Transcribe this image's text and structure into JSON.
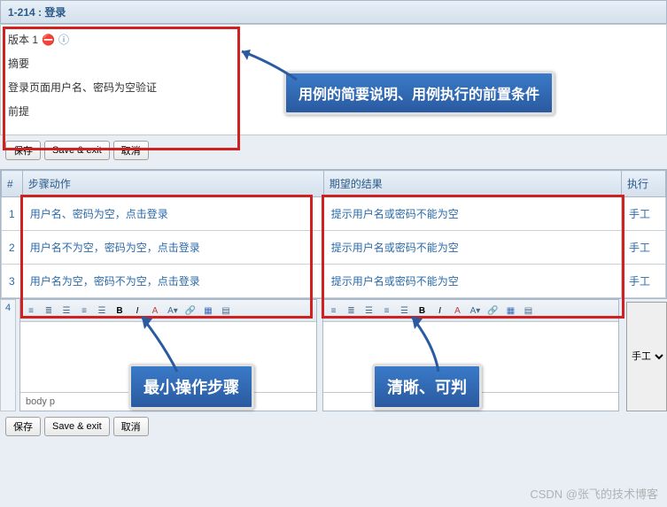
{
  "header": {
    "title": "1-214 : 登录"
  },
  "summary": {
    "version_label": "版本 1",
    "abstract_label": "摘要",
    "abstract_text": "登录页面用户名、密码为空验证",
    "precondition_label": "前提"
  },
  "buttons": {
    "save": "保存",
    "save_exit": "Save & exit",
    "cancel": "取消"
  },
  "table": {
    "headers": {
      "idx": "#",
      "action": "步骤动作",
      "expect": "期望的结果",
      "exec": "执行"
    },
    "rows": [
      {
        "idx": "1",
        "action": "用户名、密码为空，点击登录",
        "expect": "提示用户名或密码不能为空",
        "exec": "手工"
      },
      {
        "idx": "2",
        "action": "用户名不为空，密码为空，点击登录",
        "expect": "提示用户名或密码不能为空",
        "exec": "手工"
      },
      {
        "idx": "3",
        "action": "用户名为空，密码不为空，点击登录",
        "expect": "提示用户名或密码不能为空",
        "exec": "手工"
      }
    ],
    "new_idx": "4"
  },
  "editor": {
    "foot": "body  p",
    "exec_option": "手工"
  },
  "callouts": {
    "c1": "用例的简要说明、用例执行的前置条件",
    "c2": "最小操作步骤",
    "c3": "清晰、可判"
  },
  "watermark": "CSDN @张飞的技术博客"
}
